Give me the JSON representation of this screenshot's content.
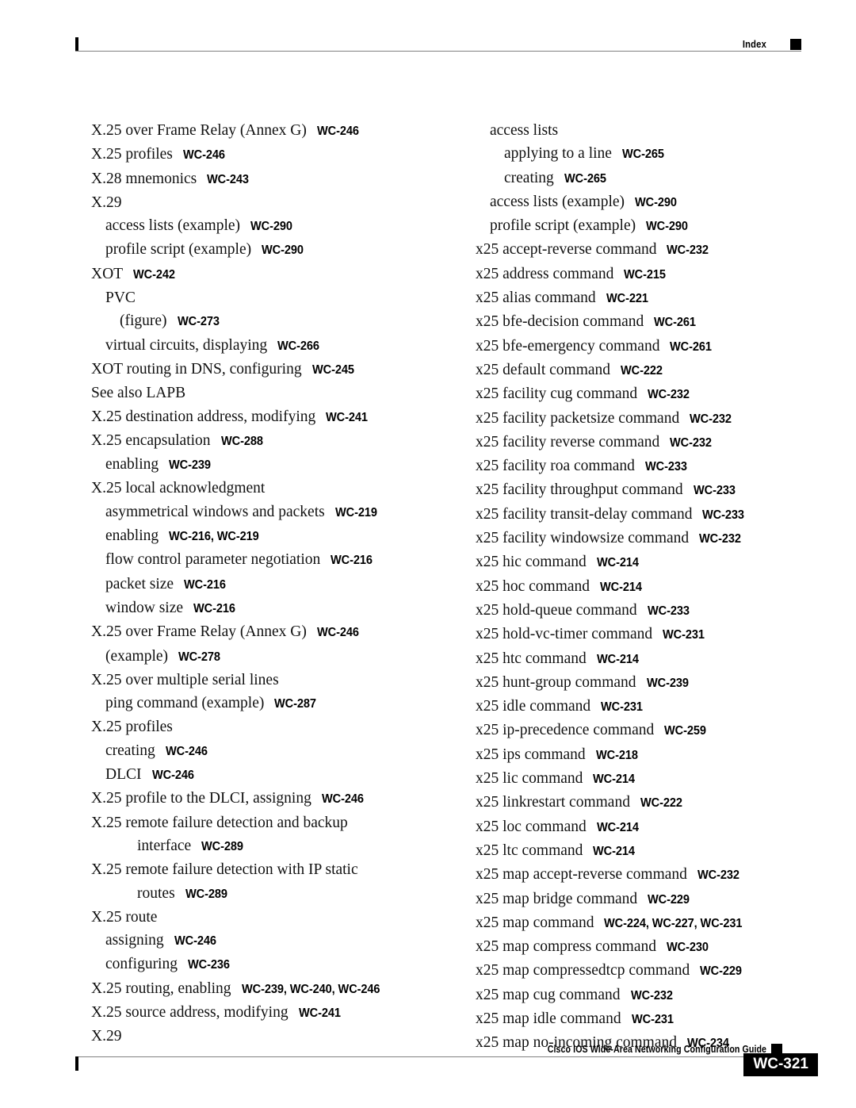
{
  "header": {
    "label": "Index",
    "square_icon": "black-square-marker",
    "tick_icon": "change-bar-tick"
  },
  "footer": {
    "guide_title": "Cisco IOS Wide-Area Networking Configuration Guide",
    "square_icon": "black-square-marker",
    "page_number": "WC-321",
    "tick_icon": "change-bar-tick"
  },
  "columns": {
    "left": [
      {
        "level": 0,
        "text": "X.25 over Frame Relay (Annex G)",
        "pages": "WC-246"
      },
      {
        "level": 0,
        "text": "X.25 profiles",
        "pages": "WC-246"
      },
      {
        "level": 0,
        "text": "X.28 mnemonics",
        "pages": "WC-243"
      },
      {
        "level": 0,
        "text": "X.29",
        "pages": ""
      },
      {
        "level": 1,
        "text": "access lists (example)",
        "pages": "WC-290"
      },
      {
        "level": 1,
        "text": "profile script (example)",
        "pages": "WC-290"
      },
      {
        "level": 0,
        "text": "XOT",
        "pages": "WC-242"
      },
      {
        "level": 1,
        "text": "PVC",
        "pages": ""
      },
      {
        "level": 2,
        "text": "(figure)",
        "pages": "WC-273"
      },
      {
        "level": 1,
        "text": "virtual circuits, displaying",
        "pages": "WC-266"
      },
      {
        "level": 0,
        "text": "XOT routing in DNS, configuring",
        "pages": "WC-245"
      },
      {
        "level": 0,
        "text": "See also LAPB",
        "pages": ""
      },
      {
        "level": 0,
        "text": "X.25 destination address, modifying",
        "pages": "WC-241"
      },
      {
        "level": 0,
        "text": "X.25 encapsulation",
        "pages": "WC-288"
      },
      {
        "level": 1,
        "text": "enabling",
        "pages": "WC-239"
      },
      {
        "level": 0,
        "text": "X.25 local acknowledgment",
        "pages": ""
      },
      {
        "level": 1,
        "text": "asymmetrical windows and packets",
        "pages": "WC-219"
      },
      {
        "level": 1,
        "text": "enabling",
        "pages": "WC-216, WC-219"
      },
      {
        "level": 1,
        "text": "flow control parameter negotiation",
        "pages": "WC-216"
      },
      {
        "level": 1,
        "text": "packet size",
        "pages": "WC-216"
      },
      {
        "level": 1,
        "text": "window size",
        "pages": "WC-216"
      },
      {
        "level": 0,
        "text": "X.25 over Frame Relay (Annex G)",
        "pages": "WC-246"
      },
      {
        "level": 1,
        "text": "(example)",
        "pages": "WC-278"
      },
      {
        "level": 0,
        "text": "X.25 over multiple serial lines",
        "pages": ""
      },
      {
        "level": 1,
        "text": "ping command (example)",
        "pages": "WC-287"
      },
      {
        "level": 0,
        "text": "X.25 profiles",
        "pages": ""
      },
      {
        "level": 1,
        "text": "creating",
        "pages": "WC-246"
      },
      {
        "level": 1,
        "text": "DLCI",
        "pages": "WC-246"
      },
      {
        "level": 0,
        "text": "X.25 profile to the DLCI, assigning",
        "pages": "WC-246"
      },
      {
        "level": 0,
        "text": "X.25 remote failure detection and backup",
        "pages": ""
      },
      {
        "level": 3,
        "text": "interface",
        "pages": "WC-289"
      },
      {
        "level": 0,
        "text": "X.25 remote failure detection with IP static",
        "pages": ""
      },
      {
        "level": 3,
        "text": "routes",
        "pages": "WC-289"
      },
      {
        "level": 0,
        "text": "X.25 route",
        "pages": ""
      },
      {
        "level": 1,
        "text": "assigning",
        "pages": "WC-246"
      },
      {
        "level": 1,
        "text": "configuring",
        "pages": "WC-236"
      },
      {
        "level": 0,
        "text": "X.25 routing, enabling",
        "pages": "WC-239, WC-240, WC-246"
      },
      {
        "level": 0,
        "text": "X.25 source address, modifying",
        "pages": "WC-241"
      },
      {
        "level": 0,
        "text": "X.29",
        "pages": ""
      }
    ],
    "right": [
      {
        "level": 1,
        "text": "access lists",
        "pages": ""
      },
      {
        "level": 2,
        "text": "applying to a line",
        "pages": "WC-265"
      },
      {
        "level": 2,
        "text": "creating",
        "pages": "WC-265"
      },
      {
        "level": 1,
        "text": "access lists (example)",
        "pages": "WC-290"
      },
      {
        "level": 1,
        "text": "profile script (example)",
        "pages": "WC-290"
      },
      {
        "level": 0,
        "text": "x25 accept-reverse command",
        "pages": "WC-232"
      },
      {
        "level": 0,
        "text": "x25 address command",
        "pages": "WC-215"
      },
      {
        "level": 0,
        "text": "x25 alias command",
        "pages": "WC-221"
      },
      {
        "level": 0,
        "text": "x25 bfe-decision command",
        "pages": "WC-261"
      },
      {
        "level": 0,
        "text": "x25 bfe-emergency command",
        "pages": "WC-261"
      },
      {
        "level": 0,
        "text": "x25 default command",
        "pages": "WC-222"
      },
      {
        "level": 0,
        "text": "x25 facility cug command",
        "pages": "WC-232"
      },
      {
        "level": 0,
        "text": "x25 facility packetsize command",
        "pages": "WC-232"
      },
      {
        "level": 0,
        "text": "x25 facility reverse command",
        "pages": "WC-232"
      },
      {
        "level": 0,
        "text": "x25 facility roa command",
        "pages": "WC-233"
      },
      {
        "level": 0,
        "text": "x25 facility throughput command",
        "pages": "WC-233"
      },
      {
        "level": 0,
        "text": "x25 facility transit-delay command",
        "pages": "WC-233"
      },
      {
        "level": 0,
        "text": "x25 facility windowsize command",
        "pages": "WC-232"
      },
      {
        "level": 0,
        "text": "x25 hic command",
        "pages": "WC-214"
      },
      {
        "level": 0,
        "text": "x25 hoc command",
        "pages": "WC-214"
      },
      {
        "level": 0,
        "text": "x25 hold-queue command",
        "pages": "WC-233"
      },
      {
        "level": 0,
        "text": "x25 hold-vc-timer command",
        "pages": "WC-231"
      },
      {
        "level": 0,
        "text": "x25 htc command",
        "pages": "WC-214"
      },
      {
        "level": 0,
        "text": "x25 hunt-group command",
        "pages": "WC-239"
      },
      {
        "level": 0,
        "text": "x25 idle command",
        "pages": "WC-231"
      },
      {
        "level": 0,
        "text": "x25 ip-precedence command",
        "pages": "WC-259"
      },
      {
        "level": 0,
        "text": "x25 ips command",
        "pages": "WC-218"
      },
      {
        "level": 0,
        "text": "x25 lic command",
        "pages": "WC-214"
      },
      {
        "level": 0,
        "text": "x25 linkrestart command",
        "pages": "WC-222"
      },
      {
        "level": 0,
        "text": "x25 loc command",
        "pages": "WC-214"
      },
      {
        "level": 0,
        "text": "x25 ltc command",
        "pages": "WC-214"
      },
      {
        "level": 0,
        "text": "x25 map accept-reverse command",
        "pages": "WC-232"
      },
      {
        "level": 0,
        "text": "x25 map bridge command",
        "pages": "WC-229"
      },
      {
        "level": 0,
        "text": "x25 map command",
        "pages": "WC-224, WC-227, WC-231"
      },
      {
        "level": 0,
        "text": "x25 map compress command",
        "pages": "WC-230"
      },
      {
        "level": 0,
        "text": "x25 map compressedtcp command",
        "pages": "WC-229"
      },
      {
        "level": 0,
        "text": "x25 map cug command",
        "pages": "WC-232"
      },
      {
        "level": 0,
        "text": "x25 map idle command",
        "pages": "WC-231"
      },
      {
        "level": 0,
        "text": "x25 map no-incoming command",
        "pages": "WC-234"
      }
    ]
  }
}
